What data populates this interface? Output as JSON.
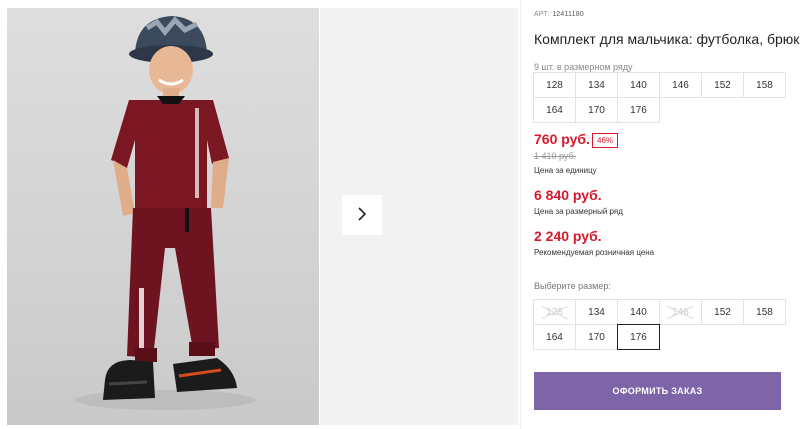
{
  "product": {
    "article_label": "АРТ:",
    "article_number": "12411180",
    "title": "Комплект для мальчика: футболка, брюки",
    "count_in_size_range": "9 шт. в размерном ряду"
  },
  "size_range": [
    "128",
    "134",
    "140",
    "146",
    "152",
    "158",
    "164",
    "170",
    "176"
  ],
  "prices": {
    "current": "760 руб.",
    "discount": "46%",
    "old": "1 410 руб.",
    "unit_label": "Цена за единицу",
    "size_range_price": "6 840 руб.",
    "size_range_label": "Цена за размерный ряд",
    "retail_price": "2 240 руб.",
    "retail_label": "Рекомендуемая розничная цена"
  },
  "size_picker": {
    "label": "Выберите размер:",
    "options": [
      {
        "size": "128",
        "available": false
      },
      {
        "size": "134",
        "available": true
      },
      {
        "size": "140",
        "available": true
      },
      {
        "size": "146",
        "available": false
      },
      {
        "size": "152",
        "available": true
      },
      {
        "size": "158",
        "available": true
      },
      {
        "size": "164",
        "available": true
      },
      {
        "size": "170",
        "available": true
      },
      {
        "size": "176",
        "available": true,
        "selected": true
      }
    ]
  },
  "order_button": "Оформить заказ",
  "colors": {
    "price_red": "#d7192d",
    "button_purple": "#7d65a8",
    "outfit_burgundy": "#7a1722"
  },
  "icons": {
    "next": "chevron-right-icon"
  }
}
